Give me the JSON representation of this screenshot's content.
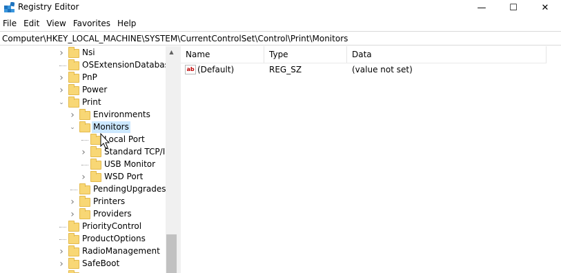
{
  "window": {
    "title": "Registry Editor",
    "controls": {
      "minimize": "—",
      "maximize": "☐",
      "close": "✕"
    }
  },
  "menu": [
    "File",
    "Edit",
    "View",
    "Favorites",
    "Help"
  ],
  "address": "Computer\\HKEY_LOCAL_MACHINE\\SYSTEM\\CurrentControlSet\\Control\\Print\\Monitors",
  "tree": {
    "items": [
      {
        "label": "Nsi",
        "level": 1,
        "expander": "collapsed"
      },
      {
        "label": "OSExtensionDatabase",
        "level": 1,
        "expander": "none"
      },
      {
        "label": "PnP",
        "level": 1,
        "expander": "collapsed"
      },
      {
        "label": "Power",
        "level": 1,
        "expander": "collapsed"
      },
      {
        "label": "Print",
        "level": 1,
        "expander": "expanded"
      },
      {
        "label": "Environments",
        "level": 2,
        "expander": "collapsed"
      },
      {
        "label": "Monitors",
        "level": 2,
        "expander": "expanded",
        "selected": true
      },
      {
        "label": "Local Port",
        "level": 3,
        "expander": "none"
      },
      {
        "label": "Standard TCP/IP Port",
        "level": 3,
        "expander": "collapsed"
      },
      {
        "label": "USB Monitor",
        "level": 3,
        "expander": "none"
      },
      {
        "label": "WSD Port",
        "level": 3,
        "expander": "collapsed"
      },
      {
        "label": "PendingUpgrades",
        "level": 2,
        "expander": "none"
      },
      {
        "label": "Printers",
        "level": 2,
        "expander": "collapsed"
      },
      {
        "label": "Providers",
        "level": 2,
        "expander": "collapsed"
      },
      {
        "label": "PriorityControl",
        "level": 1,
        "expander": "none"
      },
      {
        "label": "ProductOptions",
        "level": 1,
        "expander": "none"
      },
      {
        "label": "RadioManagement",
        "level": 1,
        "expander": "collapsed"
      },
      {
        "label": "SafeBoot",
        "level": 1,
        "expander": "collapsed"
      },
      {
        "label": "",
        "level": 1,
        "expander": "collapsed"
      }
    ]
  },
  "list": {
    "columns": {
      "name": "Name",
      "type": "Type",
      "data": "Data"
    },
    "rows": [
      {
        "icon": "ab",
        "name": "(Default)",
        "type": "REG_SZ",
        "data": "(value not set)"
      }
    ]
  },
  "colors": {
    "selection": "#cce8ff",
    "folder": "#f8d775",
    "scrollbar_thumb": "#c1c1c1"
  },
  "icons": {
    "app": "registry-editor-icon",
    "folder": "folder-icon",
    "value": "string-value-icon",
    "cursor": "mouse-pointer-icon"
  }
}
